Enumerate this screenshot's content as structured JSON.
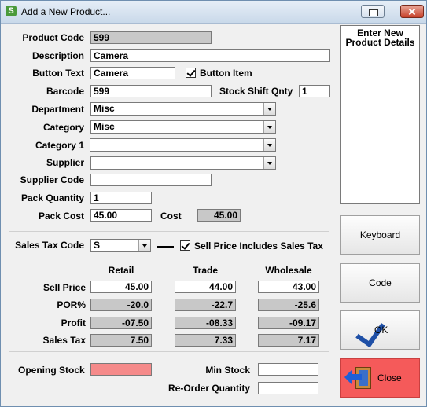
{
  "window": {
    "title": "Add a New Product...",
    "app_icon": "S"
  },
  "form": {
    "product_code": {
      "label": "Product Code",
      "value": "599"
    },
    "description": {
      "label": "Description",
      "value": "Camera"
    },
    "button_text": {
      "label": "Button Text",
      "value": "Camera"
    },
    "button_item": {
      "label": "Button Item",
      "checked": true
    },
    "barcode": {
      "label": "Barcode",
      "value": "599"
    },
    "stock_shift_qnty": {
      "label": "Stock Shift Qnty",
      "value": "1"
    },
    "department": {
      "label": "Department",
      "value": "Misc"
    },
    "category": {
      "label": "Category",
      "value": "Misc"
    },
    "category1": {
      "label": "Category 1",
      "value": ""
    },
    "supplier": {
      "label": "Supplier",
      "value": ""
    },
    "supplier_code": {
      "label": "Supplier Code",
      "value": ""
    },
    "pack_quantity": {
      "label": "Pack Quantity",
      "value": "1"
    },
    "pack_cost": {
      "label": "Pack Cost",
      "value": "45.00"
    },
    "cost": {
      "label": "Cost",
      "value": "45.00"
    }
  },
  "sales": {
    "tax_code": {
      "label": "Sales Tax Code",
      "value": "S"
    },
    "sell_price_includes_tax": {
      "label": "Sell Price Includes Sales Tax",
      "checked": true
    },
    "columns": [
      "Retail",
      "Trade",
      "Wholesale"
    ],
    "rows": [
      {
        "label": "Sell Price",
        "values": [
          "45.00",
          "44.00",
          "43.00"
        ]
      },
      {
        "label": "POR%",
        "values": [
          "-20.0",
          "-22.7",
          "-25.6"
        ]
      },
      {
        "label": "Profit",
        "values": [
          "-07.50",
          "-08.33",
          "-09.17"
        ]
      },
      {
        "label": "Sales Tax",
        "values": [
          "7.50",
          "7.33",
          "7.17"
        ]
      }
    ]
  },
  "stock": {
    "opening_stock": {
      "label": "Opening Stock",
      "value": ""
    },
    "min_stock": {
      "label": "Min Stock",
      "value": ""
    },
    "reorder_quantity": {
      "label": "Re-Order Quantity",
      "value": ""
    }
  },
  "info_panel": {
    "text": "Enter New Product Details"
  },
  "buttons": {
    "keyboard": "Keyboard",
    "code": "Code",
    "ok": "OK",
    "close": "Close"
  },
  "colors": {
    "opening_stock_field": "#f58a8a",
    "close_button": "#f55a5a",
    "readonly_field": "#c8c8c8"
  }
}
